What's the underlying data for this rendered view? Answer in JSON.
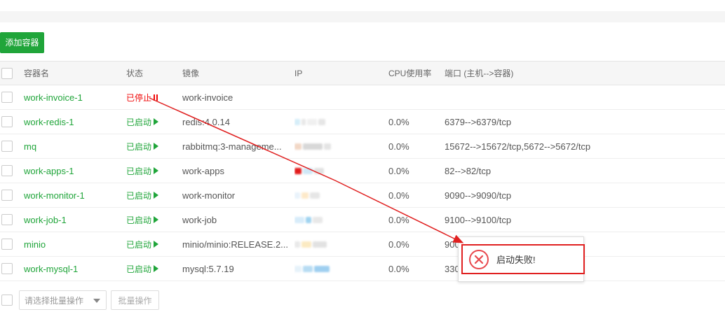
{
  "toolbar": {
    "add_label": "添加容器"
  },
  "table": {
    "headers": [
      "容器名",
      "状态",
      "镜像",
      "IP",
      "CPU使用率",
      "端口 (主机-->容器)"
    ],
    "rows": [
      {
        "name": "work-invoice-1",
        "status": "已停止",
        "state": "stopped",
        "image": "work-invoice",
        "cpu": "",
        "ports": ""
      },
      {
        "name": "work-redis-1",
        "status": "已启动",
        "state": "running",
        "image": "redis:4.0.14",
        "cpu": "0.0%",
        "ports": "6379-->6379/tcp"
      },
      {
        "name": "mq",
        "status": "已启动",
        "state": "running",
        "image": "rabbitmq:3-manageme...",
        "cpu": "0.0%",
        "ports": "15672-->15672/tcp,5672-->5672/tcp"
      },
      {
        "name": "work-apps-1",
        "status": "已启动",
        "state": "running",
        "image": "work-apps",
        "cpu": "0.0%",
        "ports": "82-->82/tcp"
      },
      {
        "name": "work-monitor-1",
        "status": "已启动",
        "state": "running",
        "image": "work-monitor",
        "cpu": "0.0%",
        "ports": "9090-->9090/tcp"
      },
      {
        "name": "work-job-1",
        "status": "已启动",
        "state": "running",
        "image": "work-job",
        "cpu": "0.0%",
        "ports": "9100-->9100/tcp"
      },
      {
        "name": "minio",
        "status": "已启动",
        "state": "running",
        "image": "minio/minio:RELEASE.2...",
        "cpu": "0.0%",
        "ports": "900"
      },
      {
        "name": "work-mysql-1",
        "status": "已启动",
        "state": "running",
        "image": "mysql:5.7.19",
        "cpu": "0.0%",
        "ports": "330"
      }
    ]
  },
  "footer": {
    "batch_placeholder": "请选择批量操作",
    "batch_button": "批量操作"
  },
  "toast": {
    "message": "启动失败!",
    "icon": "error-circle-icon"
  },
  "colors": {
    "accent": "#20a53a",
    "stopped": "#ef0808",
    "annotation": "#e02020"
  }
}
